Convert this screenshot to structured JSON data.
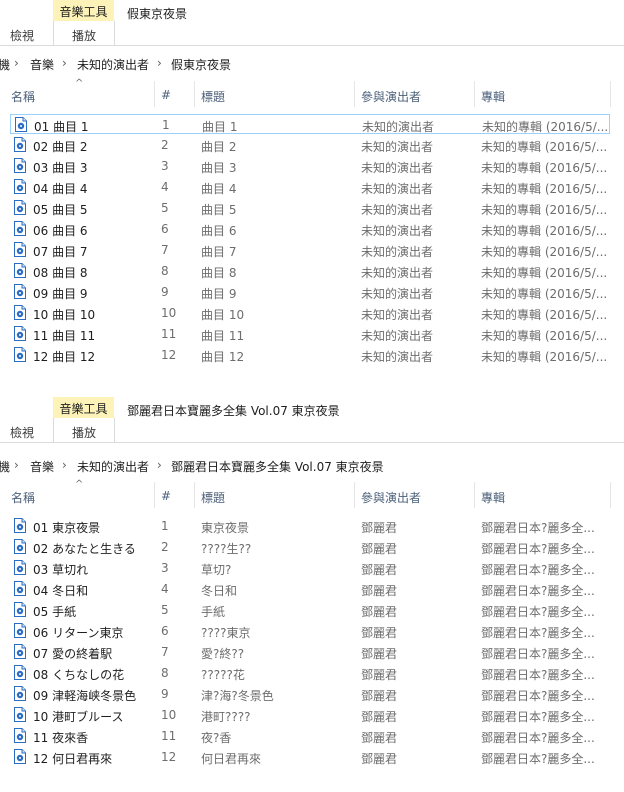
{
  "panels": [
    {
      "tool_tab": "音樂工具",
      "tab_view": "檢視",
      "tab_play": "播放",
      "window_title": "假東京夜景",
      "address": [
        "機",
        "音樂",
        "未知的演出者",
        "假東京夜景"
      ],
      "columns": {
        "name": "名稱",
        "num": "#",
        "title": "標題",
        "artist": "參與演出者",
        "album": "專輯"
      },
      "rows": [
        {
          "name": "01 曲目 1",
          "num": "1",
          "title": "曲目 1",
          "artist": "未知的演出者",
          "album": "未知的專輯 (2016/5/..."
        },
        {
          "name": "02 曲目 2",
          "num": "2",
          "title": "曲目 2",
          "artist": "未知的演出者",
          "album": "未知的專輯 (2016/5/..."
        },
        {
          "name": "03 曲目 3",
          "num": "3",
          "title": "曲目 3",
          "artist": "未知的演出者",
          "album": "未知的專輯 (2016/5/..."
        },
        {
          "name": "04 曲目 4",
          "num": "4",
          "title": "曲目 4",
          "artist": "未知的演出者",
          "album": "未知的專輯 (2016/5/..."
        },
        {
          "name": "05 曲目 5",
          "num": "5",
          "title": "曲目 5",
          "artist": "未知的演出者",
          "album": "未知的專輯 (2016/5/..."
        },
        {
          "name": "06 曲目 6",
          "num": "6",
          "title": "曲目 6",
          "artist": "未知的演出者",
          "album": "未知的專輯 (2016/5/..."
        },
        {
          "name": "07 曲目 7",
          "num": "7",
          "title": "曲目 7",
          "artist": "未知的演出者",
          "album": "未知的專輯 (2016/5/..."
        },
        {
          "name": "08 曲目 8",
          "num": "8",
          "title": "曲目 8",
          "artist": "未知的演出者",
          "album": "未知的專輯 (2016/5/..."
        },
        {
          "name": "09 曲目 9",
          "num": "9",
          "title": "曲目 9",
          "artist": "未知的演出者",
          "album": "未知的專輯 (2016/5/..."
        },
        {
          "name": "10 曲目 10",
          "num": "10",
          "title": "曲目 10",
          "artist": "未知的演出者",
          "album": "未知的專輯 (2016/5/..."
        },
        {
          "name": "11 曲目 11",
          "num": "11",
          "title": "曲目 11",
          "artist": "未知的演出者",
          "album": "未知的專輯 (2016/5/..."
        },
        {
          "name": "12 曲目 12",
          "num": "12",
          "title": "曲目 12",
          "artist": "未知的演出者",
          "album": "未知的專輯 (2016/5/..."
        }
      ]
    },
    {
      "tool_tab": "音樂工具",
      "tab_view": "檢視",
      "tab_play": "播放",
      "window_title": "鄧麗君日本寶麗多全集 Vol.07 東京夜景",
      "address": [
        "機",
        "音樂",
        "未知的演出者",
        "鄧麗君日本寶麗多全集 Vol.07 東京夜景"
      ],
      "columns": {
        "name": "名稱",
        "num": "#",
        "title": "標題",
        "artist": "參與演出者",
        "album": "專輯"
      },
      "rows": [
        {
          "name": "01 東京夜景",
          "num": "1",
          "title": "東京夜景",
          "artist": "鄧麗君",
          "album": "鄧麗君日本?麗多全..."
        },
        {
          "name": "02 あなたと生きる",
          "num": "2",
          "title": "????生??",
          "artist": "鄧麗君",
          "album": "鄧麗君日本?麗多全..."
        },
        {
          "name": "03 草切れ",
          "num": "3",
          "title": "草切?",
          "artist": "鄧麗君",
          "album": "鄧麗君日本?麗多全..."
        },
        {
          "name": "04 冬日和",
          "num": "4",
          "title": "冬日和",
          "artist": "鄧麗君",
          "album": "鄧麗君日本?麗多全..."
        },
        {
          "name": "05 手紙",
          "num": "5",
          "title": "手紙",
          "artist": "鄧麗君",
          "album": "鄧麗君日本?麗多全..."
        },
        {
          "name": "06 リターン東京",
          "num": "6",
          "title": "????東京",
          "artist": "鄧麗君",
          "album": "鄧麗君日本?麗多全..."
        },
        {
          "name": "07 愛の終着駅",
          "num": "7",
          "title": "愛?終??",
          "artist": "鄧麗君",
          "album": "鄧麗君日本?麗多全..."
        },
        {
          "name": "08 くちなしの花",
          "num": "8",
          "title": "?????花",
          "artist": "鄧麗君",
          "album": "鄧麗君日本?麗多全..."
        },
        {
          "name": "09 津軽海峡冬景色",
          "num": "9",
          "title": "津?海?冬景色",
          "artist": "鄧麗君",
          "album": "鄧麗君日本?麗多全..."
        },
        {
          "name": "10 港町ブルース",
          "num": "10",
          "title": "港町????",
          "artist": "鄧麗君",
          "album": "鄧麗君日本?麗多全..."
        },
        {
          "name": "11 夜來香",
          "num": "11",
          "title": "夜?香",
          "artist": "鄧麗君",
          "album": "鄧麗君日本?麗多全..."
        },
        {
          "name": "12 何日君再來",
          "num": "12",
          "title": "何日君再來",
          "artist": "鄧麗君",
          "album": "鄧麗君日本?麗多全..."
        }
      ]
    }
  ],
  "icons": {
    "file": "music-file-icon",
    "sort": "sort-ascending-icon",
    "breadcrumb_sep": "chevron-right-icon"
  },
  "colors": {
    "tool_tab_bg": "#fdf3b9",
    "column_header_text": "#4c607a",
    "selection_border": "#99d1ff",
    "file_icon": "#2b6cc4"
  }
}
